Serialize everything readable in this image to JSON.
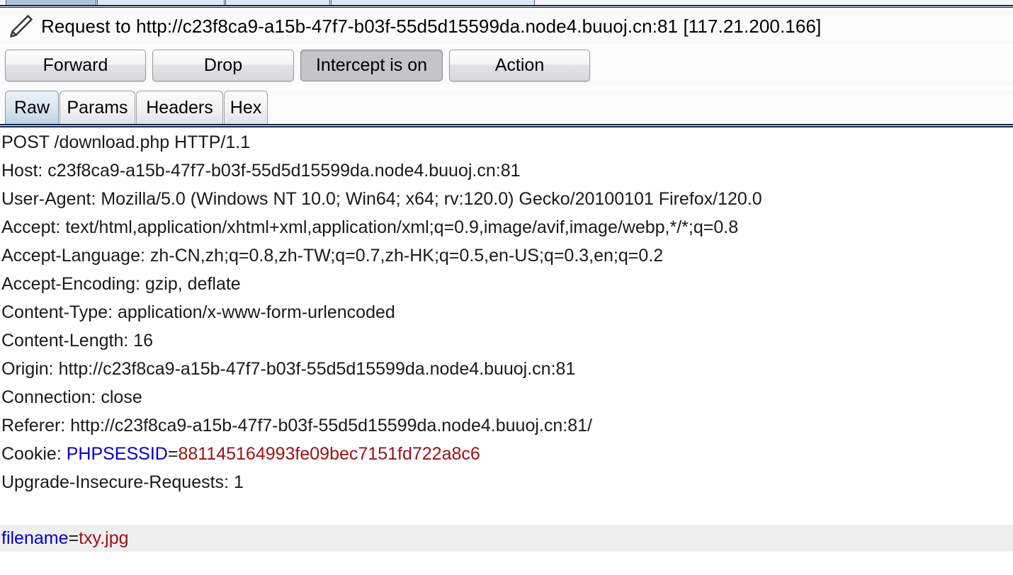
{
  "window": {
    "top_tabs": [
      {
        "label": "",
        "selected": true
      },
      {
        "label": "",
        "selected": false
      },
      {
        "label": "",
        "selected": false
      },
      {
        "label": "",
        "selected": false
      }
    ]
  },
  "header": {
    "icon": "pencil-icon",
    "title": "Request to http://c23f8ca9-a15b-47f7-b03f-55d5d15599da.node4.buuoj.cn:81  [117.21.200.166]"
  },
  "toolbar": {
    "forward_label": "Forward",
    "drop_label": "Drop",
    "intercept_label": "Intercept is on",
    "intercept_pressed": true,
    "action_label": "Action"
  },
  "tabs": [
    {
      "label": "Raw",
      "selected": true
    },
    {
      "label": "Params",
      "selected": false
    },
    {
      "label": "Headers",
      "selected": false
    },
    {
      "label": "Hex",
      "selected": false
    }
  ],
  "colors": {
    "param_name": "#0000d0",
    "param_value": "#9c1115",
    "body_highlight": "#efefef",
    "divider": "#12234a",
    "selected_tab": "#bed2e2",
    "pressed_button": "#c4c4c9"
  },
  "request": {
    "request_line": "POST /download.php HTTP/1.1",
    "headers": [
      "Host: c23f8ca9-a15b-47f7-b03f-55d5d15599da.node4.buuoj.cn:81",
      "User-Agent: Mozilla/5.0 (Windows NT 10.0; Win64; x64; rv:120.0) Gecko/20100101 Firefox/120.0",
      "Accept: text/html,application/xhtml+xml,application/xml;q=0.9,image/avif,image/webp,*/*;q=0.8",
      "Accept-Language: zh-CN,zh;q=0.8,zh-TW;q=0.7,zh-HK;q=0.5,en-US;q=0.3,en;q=0.2",
      "Accept-Encoding: gzip, deflate",
      "Content-Type: application/x-www-form-urlencoded",
      "Content-Length: 16",
      "Origin: http://c23f8ca9-a15b-47f7-b03f-55d5d15599da.node4.buuoj.cn:81",
      "Connection: close",
      "Referer: http://c23f8ca9-a15b-47f7-b03f-55d5d15599da.node4.buuoj.cn:81/"
    ],
    "cookie_header": {
      "prefix": "Cookie: ",
      "name": "PHPSESSID",
      "equals": "=",
      "value": "881145164993fe09bec7151fd722a8c6"
    },
    "trailing_headers": [
      "Upgrade-Insecure-Requests: 1"
    ],
    "body": {
      "name": "filename",
      "equals": "=",
      "value": "txy.jpg"
    }
  }
}
